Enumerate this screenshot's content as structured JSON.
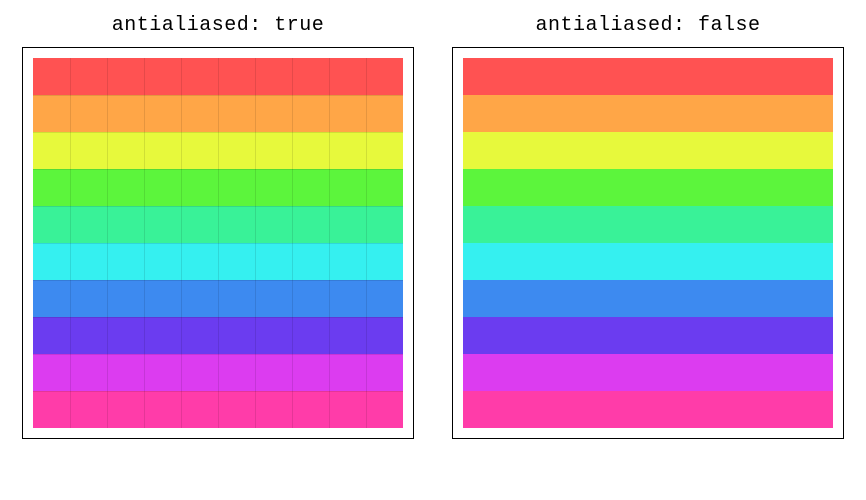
{
  "chart_data": [
    {
      "type": "heatmap",
      "title": "antialiased: true",
      "rows": 10,
      "cols": 10,
      "colormap": "hsv",
      "row_colors": [
        "#FF5252",
        "#FFA647",
        "#E7F93C",
        "#5CF53C",
        "#39F298",
        "#35F0F0",
        "#3D8AF0",
        "#6B3CF0",
        "#DC3CF0",
        "#FF3CA9"
      ],
      "antialiased": true,
      "grid_visible": true
    },
    {
      "type": "heatmap",
      "title": "antialiased: false",
      "rows": 10,
      "cols": 10,
      "colormap": "hsv",
      "row_colors": [
        "#FF5252",
        "#FFA647",
        "#E7F93C",
        "#5CF53C",
        "#39F298",
        "#35F0F0",
        "#3D8AF0",
        "#6B3CF0",
        "#DC3CF0",
        "#FF3CA9"
      ],
      "antialiased": false,
      "grid_visible": false
    }
  ]
}
